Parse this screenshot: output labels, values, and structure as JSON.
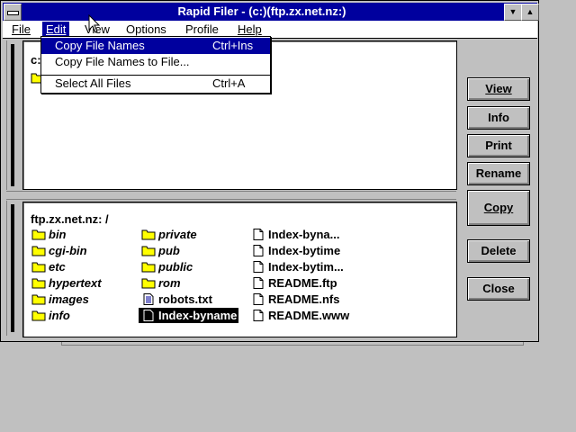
{
  "window": {
    "title": "Rapid Filer - (c:)(ftp.zx.net.nz:)"
  },
  "titlebar_buttons": {
    "min": "▼",
    "max": "▲"
  },
  "menu": [
    "File",
    "Edit",
    "View",
    "Options",
    "Profile",
    "Help"
  ],
  "menu_active": "Edit",
  "dropdown": {
    "items": [
      {
        "label": "Copy File Names",
        "shortcut": "Ctrl+Ins",
        "highlighted": true
      },
      {
        "label": "Copy File Names to File...",
        "shortcut": ""
      },
      {
        "label": "Select All Files",
        "shortcut": "Ctrl+A"
      }
    ]
  },
  "top_pane": {
    "path_stub": "c:"
  },
  "bottom_pane": {
    "path": "ftp.zx.net.nz: /",
    "directories": [
      "bin",
      "cgi-bin",
      "etc",
      "hypertext",
      "images",
      "info",
      "private",
      "pub",
      "public",
      "rom"
    ],
    "files": [
      {
        "name": "robots.txt",
        "type": "text"
      },
      {
        "name": "Index-byname",
        "type": "file",
        "selected": true
      },
      {
        "name": "Index-byna...",
        "type": "file"
      },
      {
        "name": "Index-bytime",
        "type": "file"
      },
      {
        "name": "Index-bytim...",
        "type": "file"
      },
      {
        "name": "README.ftp",
        "type": "file"
      },
      {
        "name": "README.nfs",
        "type": "file"
      },
      {
        "name": "README.www",
        "type": "file"
      }
    ]
  },
  "buttons": {
    "view": "View",
    "info": "Info",
    "print": "Print",
    "rename": "Rename",
    "copy": "Copy",
    "delete": "Delete",
    "close": "Close"
  },
  "colors": {
    "titlebar": "#00009e",
    "highlight": "#00009e",
    "folder": "#ffff00",
    "background": "#c0c0c0"
  }
}
